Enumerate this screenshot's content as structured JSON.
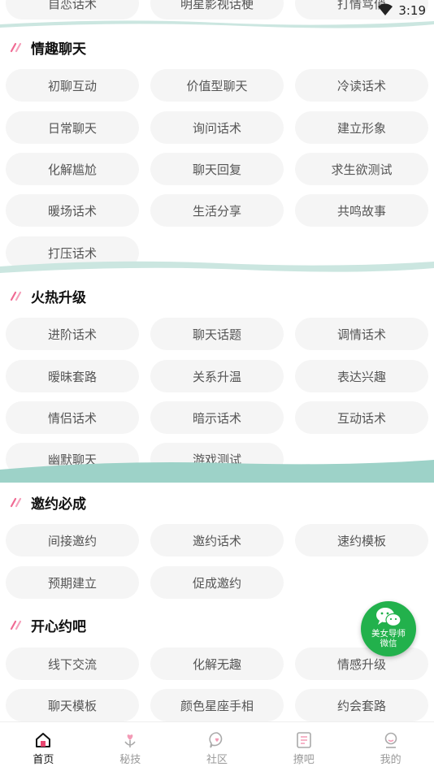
{
  "status_bar": {
    "time": "3:19"
  },
  "top_partial": [
    "自恋话术",
    "明星影视话梗",
    "打情骂俏"
  ],
  "sections": [
    {
      "title": "情趣聊天",
      "items": [
        "初聊互动",
        "价值型聊天",
        "冷读话术",
        "日常聊天",
        "询问话术",
        "建立形象",
        "化解尴尬",
        "聊天回复",
        "求生欲测试",
        "暖场话术",
        "生活分享",
        "共鸣故事",
        "打压话术"
      ]
    },
    {
      "title": "火热升级",
      "items": [
        "进阶话术",
        "聊天话题",
        "调情话术",
        "暧昧套路",
        "关系升温",
        "表达兴趣",
        "情侣话术",
        "暗示话术",
        "互动话术",
        "幽默聊天",
        "游戏测试"
      ]
    },
    {
      "title": "邀约必成",
      "items": [
        "间接邀约",
        "邀约话术",
        "速约模板",
        "预期建立",
        "促成邀约"
      ]
    },
    {
      "title": "开心约吧",
      "items": [
        "线下交流",
        "化解无趣",
        "情感升级",
        "聊天模板",
        "颜色星座手相",
        "约会套路"
      ]
    }
  ],
  "fab": {
    "line1": "美女导师",
    "line2": "微信"
  },
  "tabs": [
    {
      "label": "首页",
      "icon": "home-icon",
      "active": true
    },
    {
      "label": "秘技",
      "icon": "heart-plant-icon"
    },
    {
      "label": "社区",
      "icon": "chat-heart-icon"
    },
    {
      "label": "撩吧",
      "icon": "list-icon"
    },
    {
      "label": "我的",
      "icon": "person-icon"
    }
  ],
  "colors": {
    "wave": "#9dd2c8",
    "wave_light": "#cbe6e0",
    "accent_mark": "#f06a93",
    "fab": "#22b14c"
  }
}
